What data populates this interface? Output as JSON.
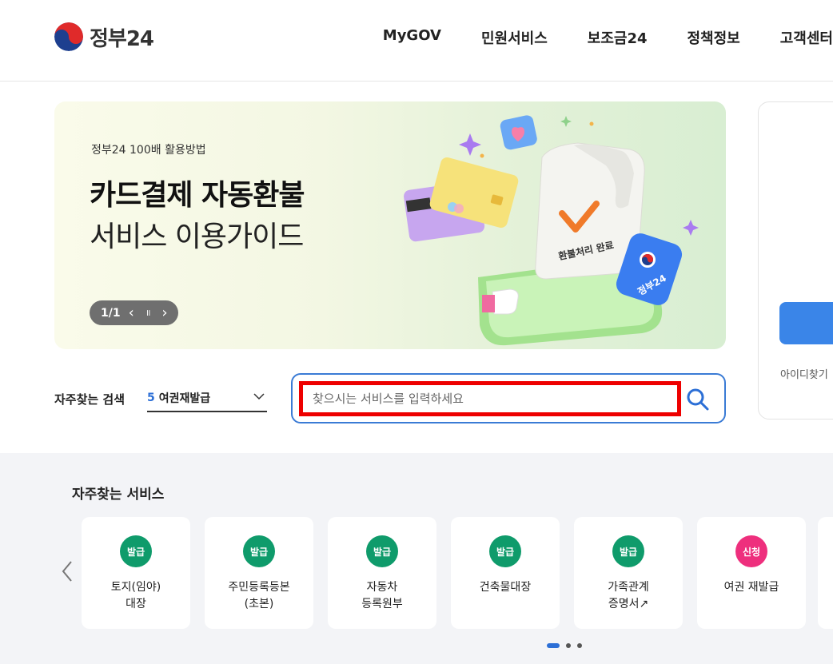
{
  "header": {
    "logo_text": "정부24",
    "nav": [
      "MyGOV",
      "민원서비스",
      "보조금24",
      "정책정보",
      "고객센터"
    ]
  },
  "banner": {
    "subtitle": "정부24 100배 활용방법",
    "title_line1": "카드결제 자동환불",
    "title_line2": "서비스 이용가이드",
    "counter": "1/1",
    "prev_label": "‹",
    "pause_label": "॥",
    "next_label": "›",
    "art_text_receipt": "환불처리 완료",
    "art_text_badge": "정부24"
  },
  "login": {
    "find_id": "아이디찾기"
  },
  "search": {
    "freq_label": "자주찾는 검색",
    "freq_rank": "5",
    "freq_value": "여권재발급",
    "placeholder": "찾으시는 서비스를 입력하세요"
  },
  "services": {
    "title": "자주찾는 서비스",
    "items": [
      {
        "badge": "발급",
        "badge_color": "#0f9b6b",
        "label": "토지(임야)\n대장"
      },
      {
        "badge": "발급",
        "badge_color": "#0f9b6b",
        "label": "주민등록등본\n(초본)"
      },
      {
        "badge": "발급",
        "badge_color": "#0f9b6b",
        "label": "자동차\n등록원부"
      },
      {
        "badge": "발급",
        "badge_color": "#0f9b6b",
        "label": "건축물대장"
      },
      {
        "badge": "발급",
        "badge_color": "#0f9b6b",
        "label": "가족관계\n증명서↗"
      },
      {
        "badge": "신청",
        "badge_color": "#ee2f7d",
        "label": "여권 재발급"
      }
    ]
  },
  "colors": {
    "accent": "#3a85e8",
    "highlight_border": "#ee0000"
  }
}
